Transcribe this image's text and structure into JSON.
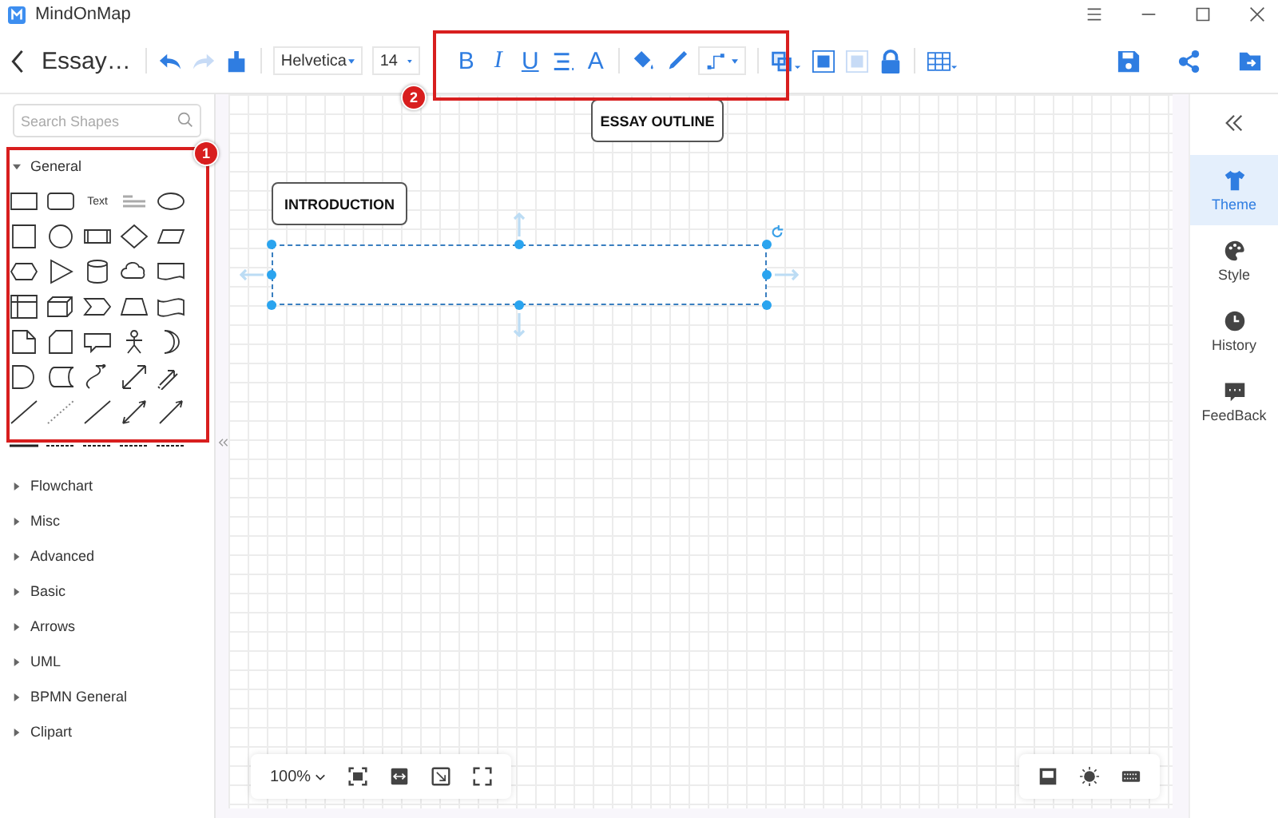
{
  "window": {
    "title": "MindOnMap"
  },
  "toolbar": {
    "document_title": "Essay…",
    "font": "Helvetica",
    "font_size": "14",
    "bold": "B",
    "italic": "I",
    "underline": "U",
    "font_color": "A"
  },
  "annotations": [
    {
      "number": "1"
    },
    {
      "number": "2"
    }
  ],
  "sidebar": {
    "search": {
      "placeholder": "Search Shapes"
    },
    "text_shape": "Text",
    "categories": [
      {
        "label": "General",
        "expanded": true
      },
      {
        "label": "Flowchart",
        "expanded": false
      },
      {
        "label": "Misc",
        "expanded": false
      },
      {
        "label": "Advanced",
        "expanded": false
      },
      {
        "label": "Basic",
        "expanded": false
      },
      {
        "label": "Arrows",
        "expanded": false
      },
      {
        "label": "UML",
        "expanded": false
      },
      {
        "label": "BPMN General",
        "expanded": false
      },
      {
        "label": "Clipart",
        "expanded": false
      }
    ]
  },
  "canvas": {
    "nodes": [
      {
        "label": "ESSAY OUTLINE",
        "selected": false
      },
      {
        "label": "INTRODUCTION",
        "selected": false
      },
      {
        "selected": true
      }
    ]
  },
  "right_panel": {
    "tabs": [
      {
        "label": "Theme",
        "selected": true
      },
      {
        "label": "Style",
        "selected": false
      },
      {
        "label": "History",
        "selected": false
      },
      {
        "label": "FeedBack",
        "selected": false
      }
    ]
  },
  "zoom": {
    "value": "100%"
  }
}
